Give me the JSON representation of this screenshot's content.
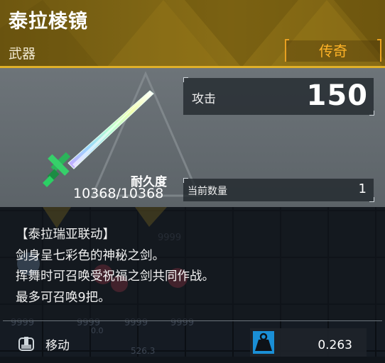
{
  "header": {
    "item_name": "泰拉棱镜",
    "item_type": "武器",
    "rarity": "传奇",
    "rarity_color": "#ffb327",
    "background_color": "#7d6414",
    "accent_line_color": "#e0b028"
  },
  "stats": {
    "attack_label": "攻击",
    "attack_value": "150",
    "durability_label": "耐久度",
    "durability_value": "10368/10368",
    "quantity_label": "当前数量",
    "quantity_value": "1"
  },
  "description": {
    "lines": [
      "【泰拉瑞亚联动】",
      "剑身呈七彩色的神秘之剑。",
      "挥舞时可召唤受祝福之剑共同作战。",
      "最多可召唤9把。"
    ]
  },
  "footer": {
    "move_label": "移动",
    "move_icon": "move-item-icon",
    "weight_icon": "weight-icon",
    "weight_value": "0.263",
    "weight_icon_color": "#1a8fd6"
  },
  "background_grid": {
    "cell_numbers": [
      "9999",
      "9999",
      "9999",
      "9999",
      "9999",
      "0.0",
      "526.3"
    ]
  }
}
